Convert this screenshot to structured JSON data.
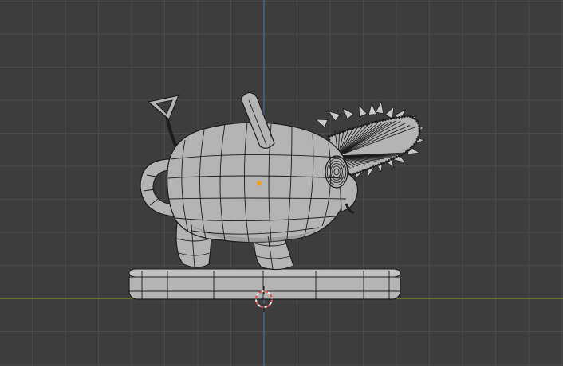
{
  "viewport": {
    "mode": "wireframe-overlay",
    "view": "front-orthographic",
    "colors": {
      "background": "#3d3d3d",
      "grid_line": "#4a4a4a",
      "x_axis": "#8aa52d",
      "z_axis": "#4a77b0",
      "mesh_fill": "#b4b4b4",
      "mesh_shadow": "#8c8c8c",
      "wire": "#1c1c1c",
      "origin_point": "#f0a020",
      "cursor_ring_red": "#e05050",
      "cursor_ring_white": "#f0f0f0"
    },
    "scene_objects": [
      {
        "name": "pochita-body-mesh",
        "selected": false
      },
      {
        "name": "chainsaw-blade-mesh",
        "selected": false
      },
      {
        "name": "base-pedestal-mesh",
        "selected": false
      }
    ],
    "icons": [
      "3d-cursor-icon",
      "object-origin-icon"
    ]
  }
}
